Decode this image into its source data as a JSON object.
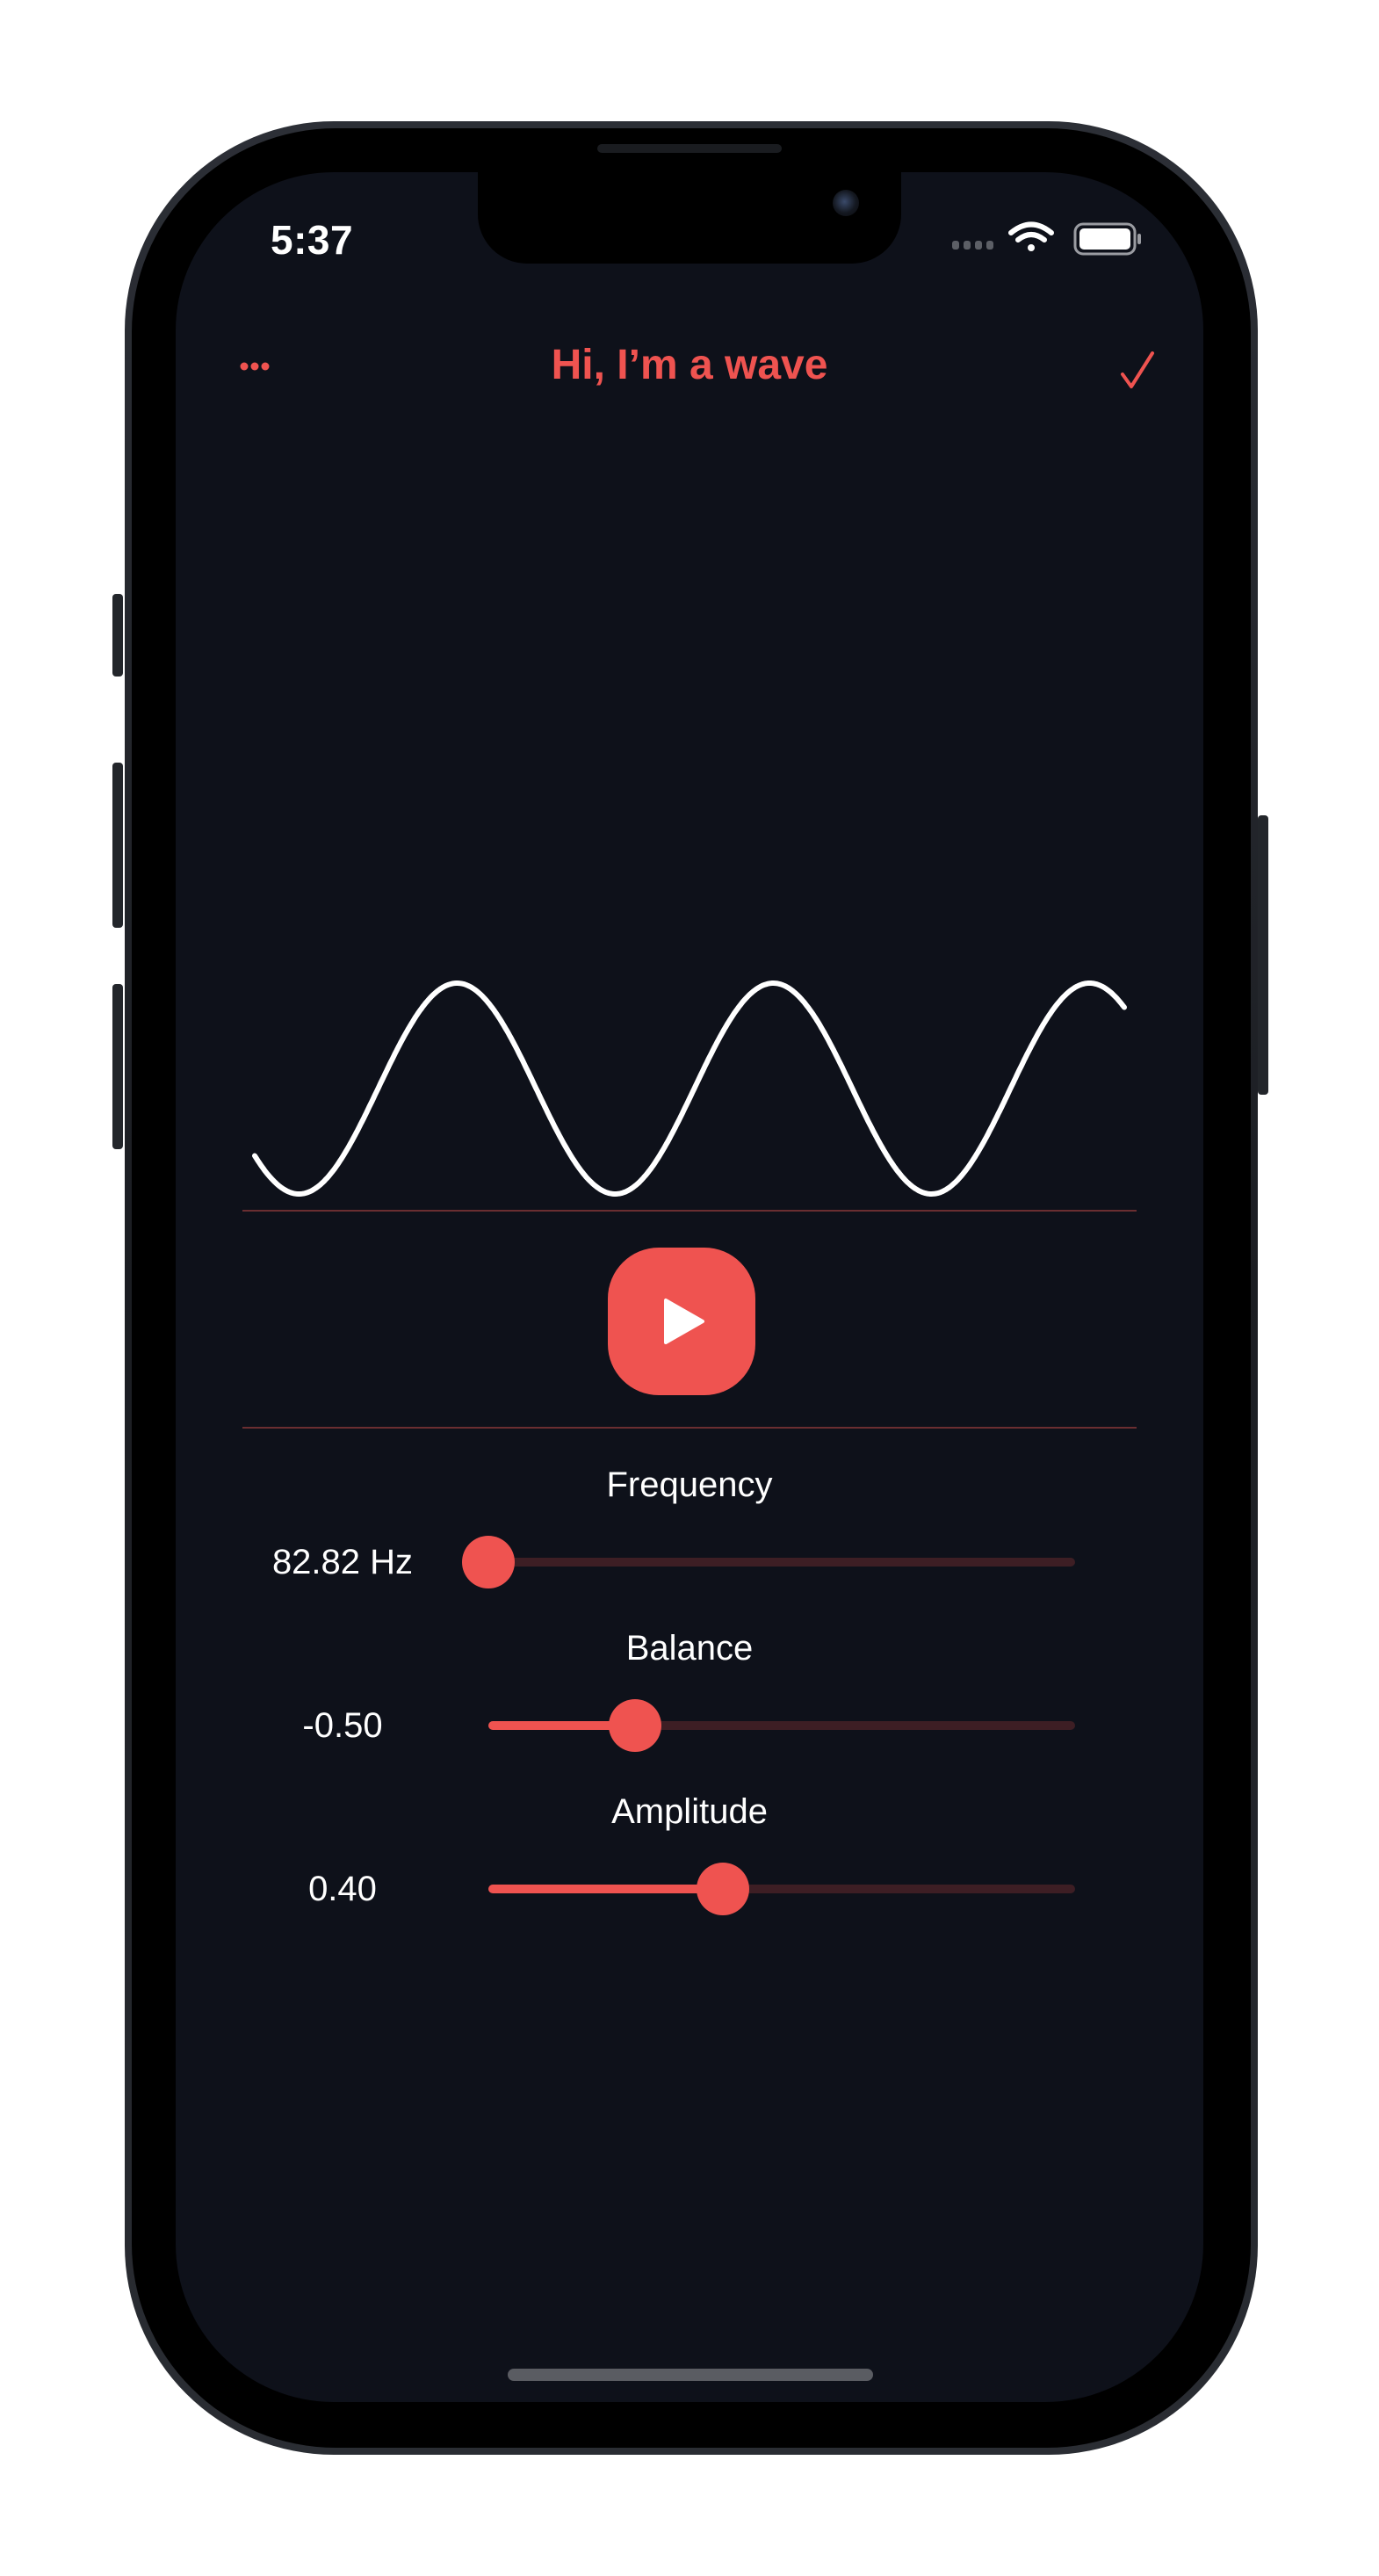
{
  "status_bar": {
    "time": "5:37"
  },
  "nav": {
    "title": "Hi, I’m a wave",
    "more_icon": "ellipsis-icon",
    "confirm_icon": "checkmark-icon"
  },
  "colors": {
    "accent": "#ef5350",
    "background": "#0e111a",
    "track_inactive": "#3d1e24",
    "divider": "#6a2e31",
    "wave": "#ffffff"
  },
  "waveform": {
    "shape": "sine",
    "cycles_visible": 2.75
  },
  "play_button": {
    "icon": "play-icon"
  },
  "controls": {
    "frequency": {
      "label": "Frequency",
      "value_text": "82.82 Hz",
      "position": 0.0
    },
    "balance": {
      "label": "Balance",
      "value_text": "-0.50",
      "position": 0.25
    },
    "amplitude": {
      "label": "Amplitude",
      "value_text": "0.40",
      "position": 0.4
    }
  }
}
